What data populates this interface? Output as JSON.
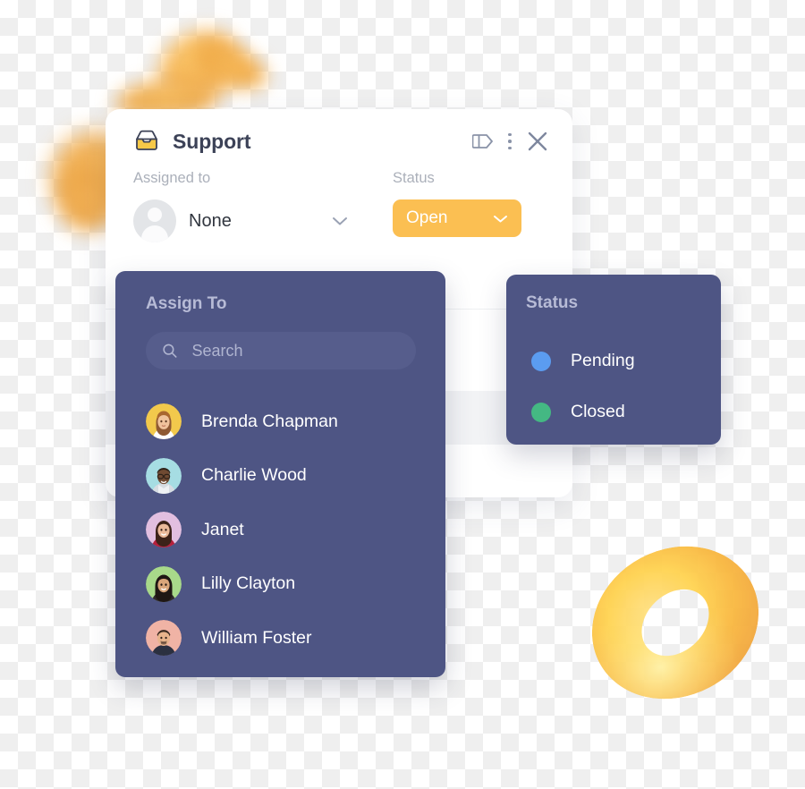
{
  "card": {
    "title": "Support",
    "inbox_icon": "inbox-tray-icon",
    "icon_color": "#f7c948",
    "header_actions": [
      {
        "name": "panel-toggle-icon",
        "label": "Toggle panel"
      },
      {
        "name": "more-options-icon",
        "label": "More options"
      },
      {
        "name": "close-icon",
        "label": "Close"
      }
    ],
    "fields": {
      "assigned": {
        "label": "Assigned to",
        "value": "None",
        "avatar": "person-placeholder-avatar",
        "caret": "chevron-down-icon"
      },
      "status": {
        "label": "Status",
        "value": "Open",
        "color": "#fbbf52",
        "caret": "chevron-down-icon"
      }
    }
  },
  "assign_popover": {
    "title": "Assign To",
    "search": {
      "placeholder": "Search",
      "value": "",
      "icon": "search-icon"
    },
    "people": [
      {
        "name": "Brenda Chapman",
        "avatar_color": "#f2c94c"
      },
      {
        "name": "Charlie Wood",
        "avatar_color": "#a6dde3"
      },
      {
        "name": "Janet",
        "avatar_color": "#e2bfe0"
      },
      {
        "name": "Lilly Clayton",
        "avatar_color": "#a8d98a"
      },
      {
        "name": "William Foster",
        "avatar_color": "#f0b3a5"
      }
    ]
  },
  "status_popover": {
    "title": "Status",
    "options": [
      {
        "label": "Pending",
        "color": "#5b9cf0"
      },
      {
        "label": "Closed",
        "color": "#44b883"
      }
    ]
  },
  "decor": {
    "torus": "torus-shape",
    "blobs": "blurred-orange-blobs"
  },
  "theme": {
    "panel_bg": "#4e5584",
    "card_bg": "#ffffff",
    "accent": "#fbbf52"
  }
}
